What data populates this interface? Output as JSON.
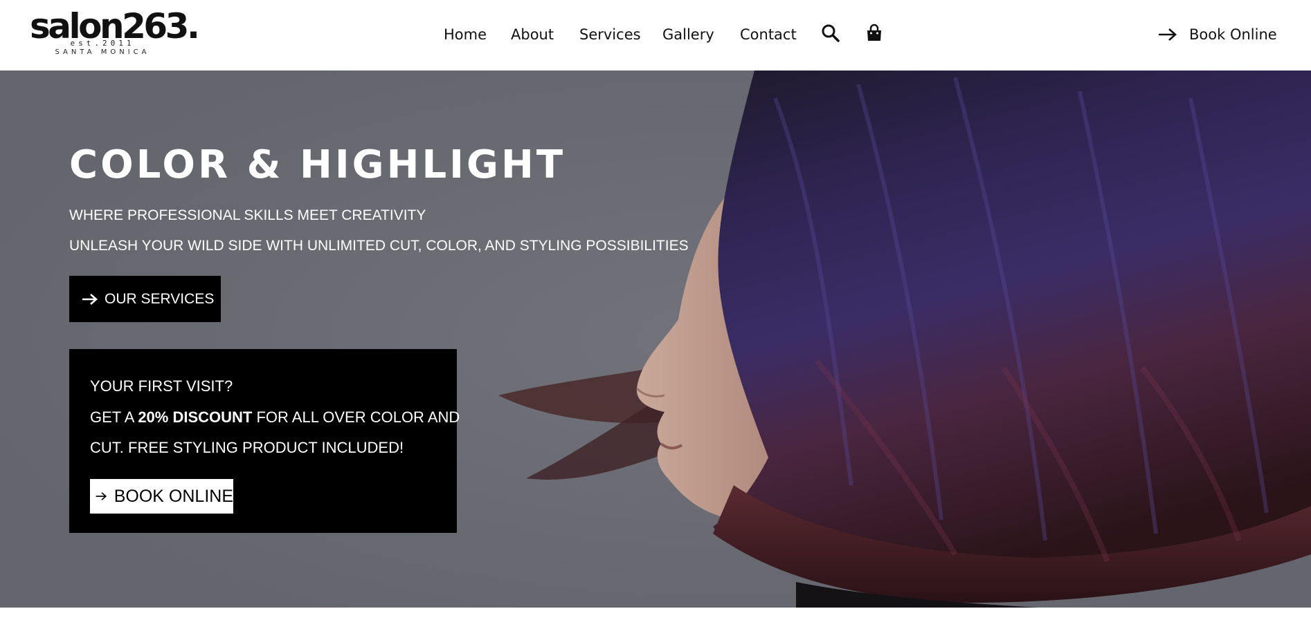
{
  "logo": {
    "brand": "salon263.",
    "est": "est.2011",
    "city": "SANTA MONICA"
  },
  "nav": {
    "items": [
      {
        "label": "Home"
      },
      {
        "label": "About"
      },
      {
        "label": "Services"
      },
      {
        "label": "Gallery"
      },
      {
        "label": "Contact"
      }
    ],
    "search_icon": "search-icon",
    "cart_icon": "shopping-bag-icon",
    "book_label": "Book Online"
  },
  "hero": {
    "title": "COLOR & HIGHLIGHT",
    "subtitle1": "WHERE PROFESSIONAL SKILLS MEET CREATIVITY",
    "subtitle2": "UNLEASH YOUR WILD SIDE WITH UNLIMITED CUT, COLOR, AND STYLING POSSIBILITIES",
    "services_button": "OUR SERVICES",
    "image": "woman-purple-bob-haircut-profile"
  },
  "promo": {
    "line1": "YOUR FIRST VISIT?",
    "line2_prefix": "GET A ",
    "line2_bold": "20% DISCOUNT",
    "line2_suffix": " FOR ALL OVER COLOR AND",
    "line3": "CUT. FREE STYLING PRODUCT INCLUDED!",
    "book_button": "BOOK ONLINE"
  },
  "colors": {
    "hero_bg": "#6b6c74",
    "button_bg": "#000000",
    "text_light": "#ffffff",
    "hair_purple": "#3a2a66",
    "hair_red": "#5a2530"
  }
}
